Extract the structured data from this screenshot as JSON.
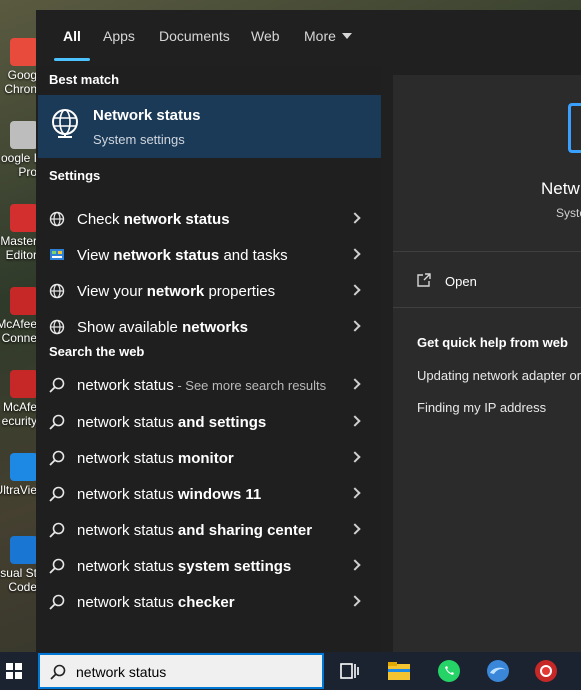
{
  "desktop": {
    "icons": [
      {
        "label1": "Goog",
        "label2": "Chron",
        "color": "#e84a3c"
      },
      {
        "label1": "oogle I",
        "label2": "Pro",
        "color": "#bdbdbd"
      },
      {
        "label1": "Master",
        "label2": "Editor",
        "color": "#d32f2f"
      },
      {
        "label1": "McAfee",
        "label2": "Conne",
        "color": "#c62828"
      },
      {
        "label1": "McAfe",
        "label2": "ecurity",
        "color": "#c62828"
      },
      {
        "label1": "UltraVie",
        "label2": "",
        "color": "#1e88e5"
      },
      {
        "label1": "isual St",
        "label2": "Code",
        "color": "#1976d2"
      }
    ]
  },
  "tabs": [
    {
      "label": "All",
      "active": true
    },
    {
      "label": "Apps"
    },
    {
      "label": "Documents"
    },
    {
      "label": "Web"
    },
    {
      "label": "More"
    }
  ],
  "best_match": {
    "section": "Best match",
    "title": "Network status",
    "subtitle": "System settings",
    "icon": "globe-monitor-icon"
  },
  "settings": {
    "section": "Settings",
    "items": [
      {
        "pre": "Check ",
        "bold": "network status",
        "post": "",
        "icon": "globe-icon"
      },
      {
        "pre": "View ",
        "bold": "network status",
        "post": " and tasks",
        "icon": "control-panel-icon"
      },
      {
        "pre": "View your ",
        "bold": "network",
        "post": " properties",
        "icon": "globe-icon"
      },
      {
        "pre": "Show available ",
        "bold": "networks",
        "post": "",
        "icon": "globe-icon"
      }
    ]
  },
  "web": {
    "section": "Search the web",
    "first": {
      "text": "network status",
      "hint": " - See more search results"
    },
    "items": [
      {
        "pre": "network status",
        "bold": " and settings"
      },
      {
        "pre": "network status",
        "bold": " monitor"
      },
      {
        "pre": "network status",
        "bold": " windows 11"
      },
      {
        "pre": "network status",
        "bold": " and sharing center"
      },
      {
        "pre": "network status",
        "bold": " system settings"
      },
      {
        "pre": "network status",
        "bold": " checker"
      }
    ]
  },
  "preview": {
    "title": "Netw",
    "subtitle": "Syste",
    "open_label": "Open",
    "quick_help": "Get quick help from web",
    "links": [
      "Updating network adapter or",
      "Finding my IP address"
    ]
  },
  "taskbar": {
    "search_value": "network status",
    "apps": [
      "task-view-icon",
      "file-explorer-icon",
      "whatsapp-icon",
      "browser-icon",
      "recorder-icon"
    ]
  },
  "colors": {
    "accent": "#4cc2ff",
    "selected_bg": "#1b3a57",
    "panel_bg": "#202020"
  }
}
